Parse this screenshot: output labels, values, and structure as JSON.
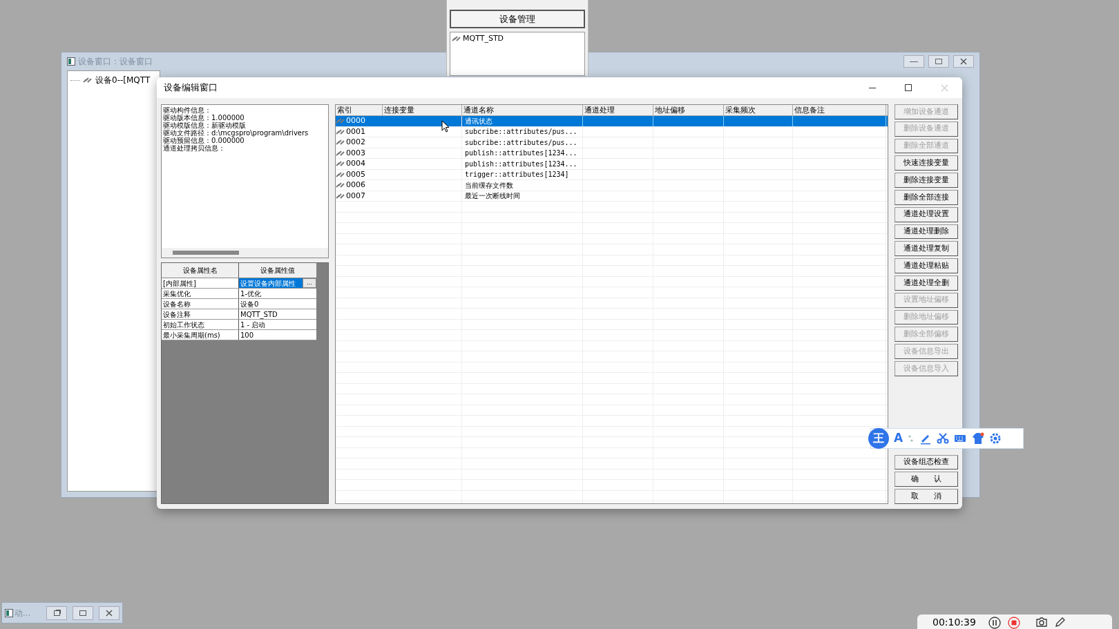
{
  "device_manager": {
    "button": "设备管理",
    "items": [
      "MQTT_STD"
    ]
  },
  "back_window": {
    "title": "设备窗口：设备窗口",
    "tree_item": "设备0--[MQTT"
  },
  "dialog": {
    "title": "设备编辑窗口",
    "info_lines": [
      "驱动构件信息：",
      "驱动版本信息：1.000000",
      "驱动模版信息：新驱动模版",
      "驱动文件路径：d:\\mcgspro\\program\\drivers",
      "驱动预留信息：0.000000",
      "通道处理拷贝信息："
    ],
    "properties": {
      "columns": [
        "设备属性名",
        "设备属性值"
      ],
      "rows": [
        {
          "name": "[内部属性]",
          "value": "设置设备内部属性",
          "selected": true,
          "ellipsis": "..."
        },
        {
          "name": "采集优化",
          "value": "1-优化",
          "selected": false
        },
        {
          "name": "设备名称",
          "value": "设备0",
          "selected": false
        },
        {
          "name": "设备注释",
          "value": "MQTT_STD",
          "selected": false
        },
        {
          "name": "初始工作状态",
          "value": "1 - 启动",
          "selected": false
        },
        {
          "name": "最小采集周期(ms)",
          "value": "100",
          "selected": false
        }
      ]
    },
    "channels": {
      "columns": [
        "索引",
        "连接变量",
        "通道名称",
        "通道处理",
        "地址偏移",
        "采集频次",
        "信息备注"
      ],
      "rows": [
        {
          "index": "0000",
          "name": "通讯状态",
          "selected": true
        },
        {
          "index": "0001",
          "name": "subcribe::attributes/pus...",
          "selected": false
        },
        {
          "index": "0002",
          "name": "subcribe::attributes/pus...",
          "selected": false
        },
        {
          "index": "0003",
          "name": "publish::attributes[1234...",
          "selected": false
        },
        {
          "index": "0004",
          "name": "publish::attributes[1234...",
          "selected": false
        },
        {
          "index": "0005",
          "name": "trigger::attributes[1234]",
          "selected": false
        },
        {
          "index": "0006",
          "name": "当前缓存文件数",
          "selected": false
        },
        {
          "index": "0007",
          "name": "最近一次断线时间",
          "selected": false
        }
      ]
    },
    "buttons": [
      {
        "label": "增加设备通道",
        "disabled": true
      },
      {
        "label": "删除设备通道",
        "disabled": true
      },
      {
        "label": "删除全部通道",
        "disabled": true
      },
      {
        "label": "快速连接变量",
        "disabled": false
      },
      {
        "label": "删除连接变量",
        "disabled": false
      },
      {
        "label": "删除全部连接",
        "disabled": false
      },
      {
        "label": "通道处理设置",
        "disabled": false
      },
      {
        "label": "通道处理删除",
        "disabled": false
      },
      {
        "label": "通道处理复制",
        "disabled": false
      },
      {
        "label": "通道处理粘贴",
        "disabled": false
      },
      {
        "label": "通道处理全删",
        "disabled": false
      },
      {
        "label": "设置地址偏移",
        "disabled": true
      },
      {
        "label": "删除地址偏移",
        "disabled": true
      },
      {
        "label": "删除全部偏移",
        "disabled": true
      },
      {
        "label": "设备信息导出",
        "disabled": true
      },
      {
        "label": "设备信息导入",
        "disabled": true
      }
    ],
    "bottom_buttons": [
      "设备组态检查",
      "确　　认",
      "取　　消"
    ]
  },
  "ime_toolbar": {
    "logo": "王",
    "font_key": "A"
  },
  "minimized_window": {
    "title": "动..."
  },
  "recorder": {
    "time": "00:10:39"
  }
}
